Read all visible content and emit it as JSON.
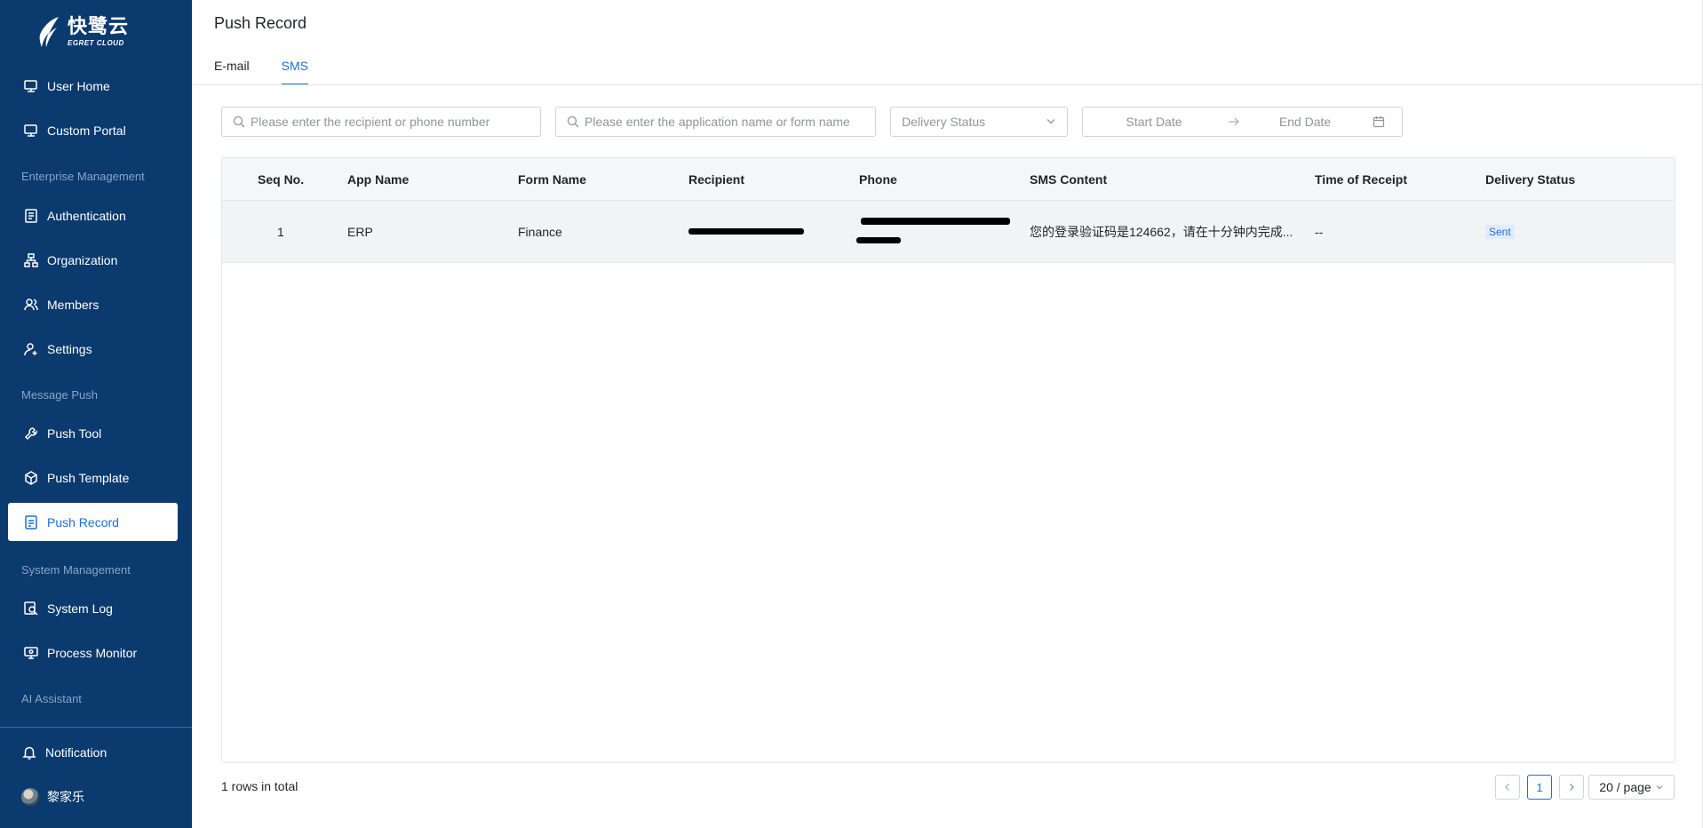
{
  "brand": {
    "name_cn": "快鹭云",
    "name_en": "EGRET CLOUD"
  },
  "sidebar": {
    "items_top": [
      {
        "label": "User Home",
        "icon": "monitor-icon"
      },
      {
        "label": "Custom Portal",
        "icon": "monitor-icon"
      }
    ],
    "sections": [
      {
        "title": "Enterprise Management"
      },
      {
        "title": "Message Push"
      },
      {
        "title": "System Management"
      },
      {
        "title": "AI Assistant"
      }
    ],
    "enterprise_items": [
      {
        "label": "Authentication",
        "icon": "id-card-icon"
      },
      {
        "label": "Organization",
        "icon": "org-tree-icon"
      },
      {
        "label": "Members",
        "icon": "users-icon"
      },
      {
        "label": "Settings",
        "icon": "user-settings-icon"
      }
    ],
    "message_items": [
      {
        "label": "Push Tool",
        "icon": "wrench-icon"
      },
      {
        "label": "Push Template",
        "icon": "cube-icon"
      },
      {
        "label": "Push Record",
        "icon": "document-icon",
        "active": true
      }
    ],
    "system_items": [
      {
        "label": "System Log",
        "icon": "search-doc-icon"
      },
      {
        "label": "Process Monitor",
        "icon": "monitor-settings-icon"
      }
    ],
    "notification": "Notification",
    "user_name": "黎家乐"
  },
  "header": {
    "title": "Push Record",
    "tabs": [
      {
        "label": "E-mail",
        "active": false
      },
      {
        "label": "SMS",
        "active": true
      }
    ]
  },
  "filters": {
    "recipient_placeholder": "Please enter the recipient or phone number",
    "app_placeholder": "Please enter the application name or form name",
    "status_placeholder": "Delivery Status",
    "start_date_placeholder": "Start Date",
    "end_date_placeholder": "End Date"
  },
  "table": {
    "columns": [
      "Seq No.",
      "App Name",
      "Form Name",
      "Recipient",
      "Phone",
      "SMS Content",
      "Time of Receipt",
      "Delivery Status"
    ],
    "rows": [
      {
        "seq": "1",
        "app": "ERP",
        "form": "Finance",
        "sms": "您的登录验证码是124662，请在十分钟内完成...",
        "time": "--",
        "status": "Sent"
      }
    ]
  },
  "pagination": {
    "total_text": "1 rows in total",
    "current_page": "1",
    "page_size": "20 / page"
  },
  "colors": {
    "sidebar_bg": "#0b3a6e",
    "accent": "#1a6fd8",
    "badge_bg": "#e1ecfb"
  }
}
